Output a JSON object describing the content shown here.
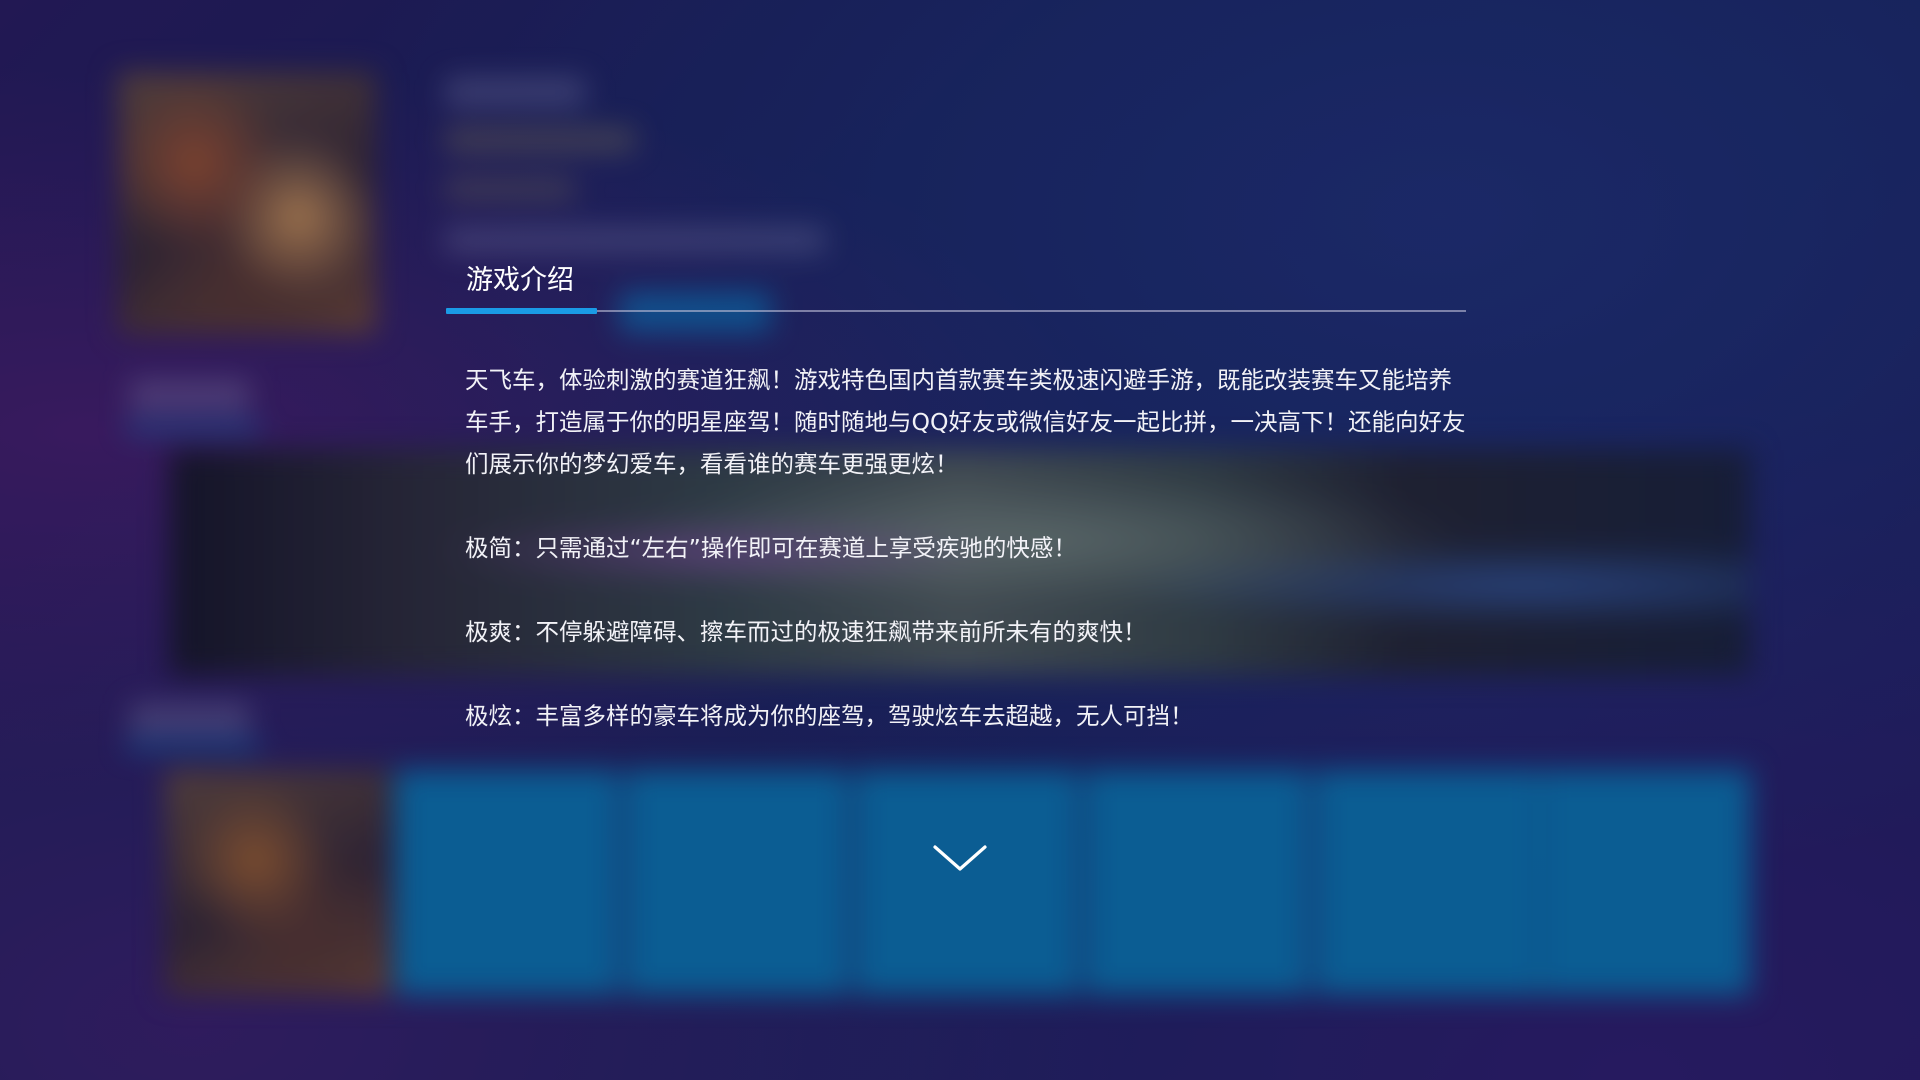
{
  "tabs": [
    {
      "label": "游戏介绍",
      "active": true
    }
  ],
  "description": {
    "main": "天飞车，体验刺激的赛道狂飙！游戏特色国内首款赛车类极速闪避手游，既能改装赛车又能培养车手，打造属于你的明星座驾！随时随地与QQ好友或微信好友一起比拼，一决高下！还能向好友们展示你的梦幻爱车，看看谁的赛车更强更炫！",
    "features": [
      "极简：只需通过“左右”操作即可在赛道上享受疾驰的快感！",
      "极爽：不停躲避障碍、擦车而过的极速狂飙带来前所未有的爽快！",
      "极炫：丰富多样的豪车将成为你的座驾，驾驶炫车去超越，无人可挡！"
    ]
  },
  "icons": {
    "scroll_down": "chevron-down-icon"
  },
  "colors": {
    "accent": "#1a9be6",
    "text": "#f2f2f7",
    "tile_blue": "#0a7ab4"
  }
}
